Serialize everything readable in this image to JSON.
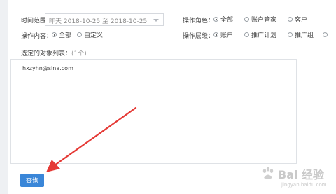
{
  "filters": {
    "time_range_label": "时间范围：",
    "date_range_value": "昨天 2018-10-25 至 2018-10-25",
    "role_label": "操作角色：",
    "role_options": [
      "全部",
      "账户管家",
      "客户"
    ],
    "role_selected_index": 0,
    "content_label": "操作内容：",
    "content_options": [
      "全部",
      "自定义"
    ],
    "content_selected_index": 0,
    "level_label": "操作层级：",
    "level_options": [
      "账户",
      "推广计划",
      "推广组"
    ],
    "level_selected_index": 0
  },
  "selected_objects": {
    "title": "选定的对象列表：",
    "count_text": "(1个)",
    "items": [
      "hxzyhn@sina.com"
    ]
  },
  "query_button_label": "查询",
  "watermark": {
    "text": "Bai 经验",
    "sub": "jingyan.baidu.com"
  },
  "colors": {
    "button": "#3a86d8",
    "arrow": "#e53935",
    "background": "#eef0f3"
  }
}
